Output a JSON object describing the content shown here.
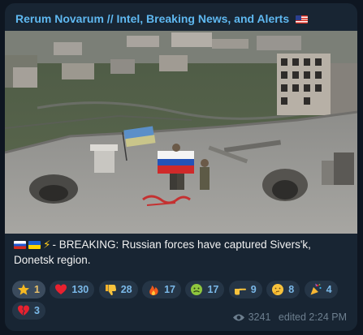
{
  "post": {
    "channel_title": "Rerum Novarum // Intel, Breaking News, and Alerts",
    "channel_title_flag": "flag-us-icon",
    "text": "- BREAKING: Russian forces have captured Sivers'k, Donetsk region.",
    "text_prefix_icons": [
      "flag-ru-icon",
      "flag-ua-icon",
      "high-voltage-icon"
    ]
  },
  "reactions": [
    {
      "icon": "star-icon",
      "count": "1",
      "own": true
    },
    {
      "icon": "red-heart-icon",
      "count": "130"
    },
    {
      "icon": "thumbs-down-icon",
      "count": "28"
    },
    {
      "icon": "fire-icon",
      "count": "17"
    },
    {
      "icon": "nauseated-face-icon",
      "count": "17"
    },
    {
      "icon": "pointing-hand-icon",
      "count": "9"
    },
    {
      "icon": "thinking-face-icon",
      "count": "8"
    },
    {
      "icon": "party-popper-icon",
      "count": "4"
    },
    {
      "icon": "broken-heart-icon",
      "count": "3"
    }
  ],
  "meta": {
    "views": "3241",
    "edited": "edited 2:24 PM"
  },
  "colors": {
    "background": "#0e1621",
    "bubble": "#182533",
    "channel_title": "#5fb8f0",
    "reaction_chip": "#253546",
    "reaction_count": "#7ab8e8",
    "meta_text": "#6d7f8f"
  }
}
